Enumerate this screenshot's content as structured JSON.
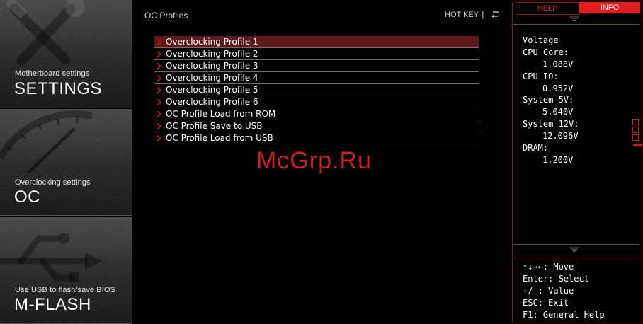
{
  "nav": {
    "settings": {
      "subtitle": "Motherboard settings",
      "title": "SETTINGS"
    },
    "oc": {
      "subtitle": "Overclocking settings",
      "title": "OC"
    },
    "mflash": {
      "subtitle": "Use USB to flash/save BIOS",
      "title": "M-FLASH"
    }
  },
  "main": {
    "title": "OC Profiles",
    "hotkey_label": "HOT KEY",
    "hotkey_separator": "|",
    "items": [
      {
        "label": "Overclocking Profile 1",
        "active": true
      },
      {
        "label": "Overclocking Profile 2"
      },
      {
        "label": "Overclocking Profile 3"
      },
      {
        "label": "Overclocking Profile 4"
      },
      {
        "label": "Overclocking Profile 5"
      },
      {
        "label": "Overclocking Profile 6"
      },
      {
        "label": "OC Profile Load from ROM"
      },
      {
        "label": "OC Profile Save to USB"
      },
      {
        "label": "OC Profile Load from USB"
      }
    ]
  },
  "watermark": "McGrp.Ru",
  "right": {
    "tab_help": "HELP",
    "tab_info": "INFO",
    "info": {
      "heading": "Voltage",
      "cpu_core_label": "CPU Core:",
      "cpu_core_value": "1.088V",
      "cpu_io_label": "CPU IO:",
      "cpu_io_value": "0.952V",
      "sys5_label": "System 5V:",
      "sys5_value": "5.040V",
      "sys12_label": "System 12V:",
      "sys12_value": "12.096V",
      "dram_label": "DRAM:",
      "dram_value": "1.200V"
    },
    "help": {
      "move": "↑↓→←: Move",
      "select": "Enter: Select",
      "value": "+/-: Value",
      "exit": "ESC: Exit",
      "general": "F1: General Help"
    }
  },
  "colors": {
    "accent_red": "#e21b1b",
    "selected_row": "#5c1a1e",
    "frame_red": "#8a1a1a"
  },
  "icons": [
    "tools-icon",
    "gauge-icon",
    "usb-icon",
    "chevron-right-icon",
    "back-icon",
    "grip-icon"
  ]
}
